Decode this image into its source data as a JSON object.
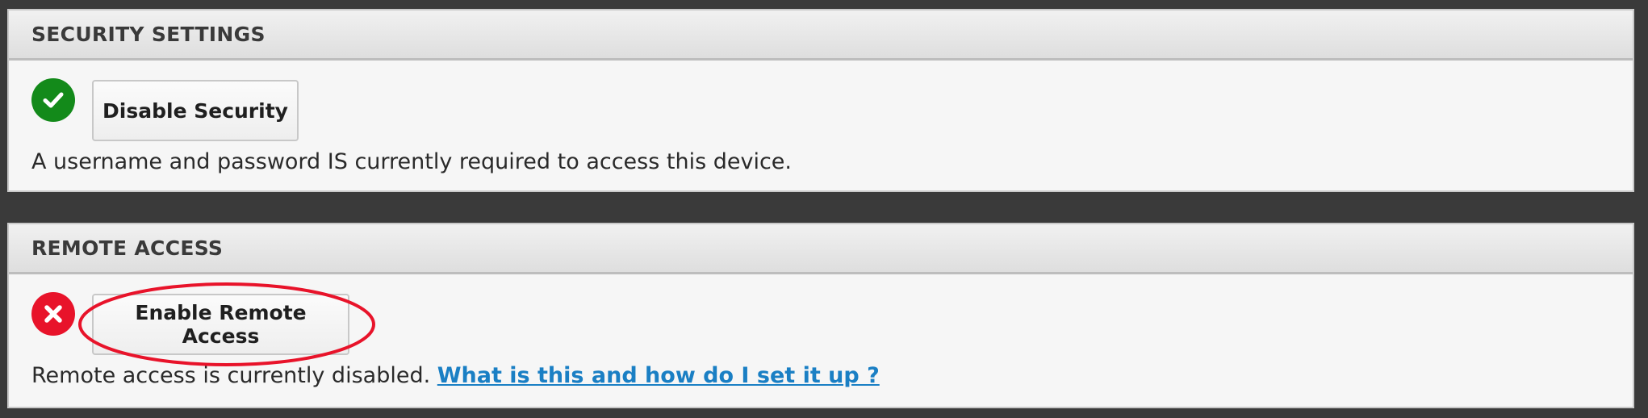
{
  "security": {
    "title": "SECURITY SETTINGS",
    "status_icon": "check-circle-icon",
    "status_color": "#138a1a",
    "button_label": "Disable Security",
    "status_text": "A username and password IS currently required to access this device."
  },
  "remote": {
    "title": "REMOTE ACCESS",
    "status_icon": "x-circle-icon",
    "status_color": "#e8132a",
    "button_label": "Enable Remote Access",
    "status_text": "Remote access is currently disabled.",
    "help_link": "What is this and how do I set it up ?"
  },
  "colors": {
    "background": "#3a3a3a",
    "link": "#1a7fc4",
    "annotation": "#e8132a"
  }
}
